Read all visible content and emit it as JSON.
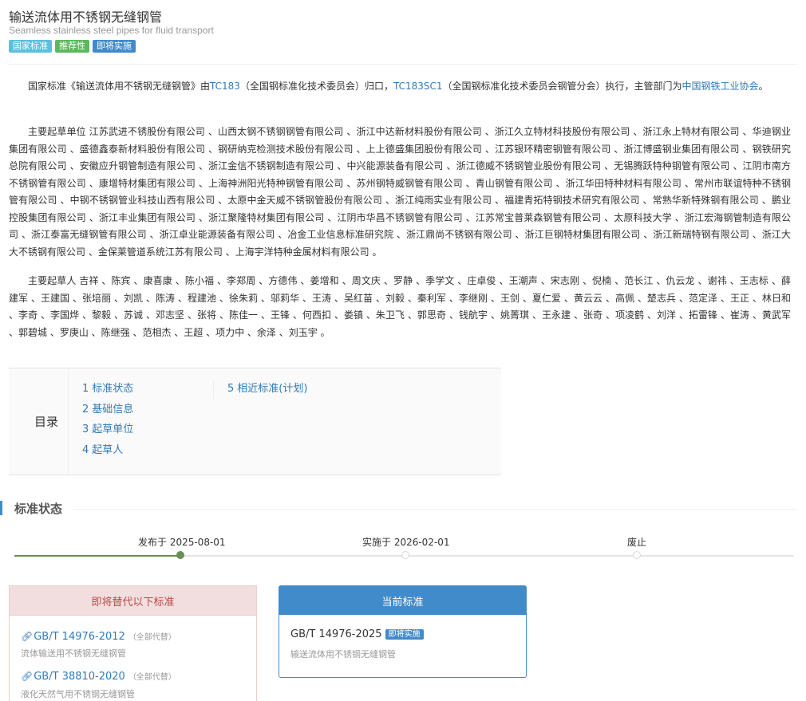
{
  "header": {
    "title": "输送流体用不锈钢无缝钢管",
    "subtitle": "Seamless stainless steel pipes for fluid transport",
    "badges": [
      "国家标准",
      "推荐性",
      "即将实施"
    ]
  },
  "intro": {
    "t1": "国家标准《输送流体用不锈钢无缝钢管》由",
    "tc1": "TC183",
    "t2": "（全国钢标准化技术委员会）归口，",
    "tc2": "TC183SC1",
    "t3": "（全国钢标准化技术委员会钢管分会）执行，主管部门为",
    "org": "中国钢铁工业协会",
    "t4": "。"
  },
  "drafting_units": "主要起草单位 江苏武进不锈股份有限公司 、山西太钢不锈钢钢管有限公司 、浙江中达新材料股份有限公司 、浙江久立特材科技股份有限公司 、浙江永上特材有限公司 、华迪钢业集团有限公司 、盛德鑫泰新材料股份有限公司 、钢研纳克检测技术股份有限公司 、上上德盛集团股份有限公司 、江苏银环精密钢管有限公司 、浙江博盛钢业集团有限公司 、钢铁研究总院有限公司 、安徽应升钢管制造有限公司 、浙江金信不锈钢制造有限公司 、中兴能源装备有限公司 、浙江德威不锈钢管业股份有限公司 、无锡腾跃特种钢管有限公司 、江阴市南方不锈钢管有限公司 、康增特材集团有限公司 、上海神洲阳光特种钢管有限公司 、苏州钢特威钢管有限公司 、青山钢管有限公司 、浙江华田特种材料有限公司 、常州市联谊特种不锈钢管有限公司 、中钢不锈钢管业科技山西有限公司 、太原中金天威不锈钢管股份有限公司 、浙江纯雨实业有限公司 、福建青拓特钢技术研究有限公司 、常熟华新特殊钢有限公司 、鹏业控股集团有限公司 、浙江丰业集团有限公司 、浙江聚隆特材集团有限公司 、江阴市华昌不锈钢管有限公司 、江苏常宝普莱森钢管有限公司 、太原科技大学 、浙江宏海钢管制造有限公司 、浙江泰富无缝钢管有限公司 、浙江卓业能源装备有限公司 、冶金工业信息标准研究院 、浙江鼎尚不锈钢有限公司 、浙江巨钢特材集团有限公司 、浙江新瑞特钢有限公司 、浙江大大不锈钢有限公司 、金保莱管道系统江苏有限公司 、上海宇洋特种金属材料有限公司 。",
  "drafters": "主要起草人 吉祥 、陈宾 、康喜康 、陈小福 、李郑周 、方德伟 、姜增和 、周文庆 、罗静 、季学文 、庄卓俊 、王潮声 、宋志刚 、倪楠 、范长江 、仇云龙 、谢祎 、王志标 、薛建军 、王建国 、张培丽 、刘凯 、陈涛 、程建池 、徐朱莉 、邬莉华 、王涛 、吴红苗 、刘毅 、秦利军 、李继刚 、王剑 、夏仁爱 、黄云云 、高佩 、楚志兵 、范定泽 、王正 、林日和 、李奇 、李国烨 、黎毅 、苏诚 、邓志坚 、张将 、陈佳一 、王锋 、何西扣 、娄镇 、朱卫飞 、郭思奇 、钱航宇 、姚菁琪 、王永建 、张奇 、项凌鹤 、刘洋 、拓雷锋 、崔涛 、黄武军 、郭碧城 、罗庚山 、陈继强 、范相杰 、王超 、项力中 、余泽 、刘玉宇 。",
  "toc": {
    "label": "目录",
    "items": [
      {
        "num": "1",
        "label": "标准状态"
      },
      {
        "num": "2",
        "label": "基础信息"
      },
      {
        "num": "3",
        "label": "起草单位"
      },
      {
        "num": "4",
        "label": "起草人"
      },
      {
        "num": "5",
        "label": "相近标准(计划)"
      }
    ]
  },
  "status_section": {
    "title": "标准状态",
    "timeline": [
      {
        "label": "发布于 2025-08-01",
        "state": "done"
      },
      {
        "label": "实施于 2026-02-01",
        "state": "pending"
      },
      {
        "label": "废止",
        "state": "pending"
      }
    ]
  },
  "replace_card": {
    "title": "即将替代以下标准",
    "items": [
      {
        "code": "GB/T 14976-2012",
        "tag": "（全部代替）",
        "name": "流体输送用不锈钢无缝钢管"
      },
      {
        "code": "GB/T 38810-2020",
        "tag": "（全部代替）",
        "name": "液化天然气用不锈钢无缝钢管"
      }
    ]
  },
  "current_card": {
    "title": "当前标准",
    "code": "GB/T 14976-2025",
    "badge": "即将实施",
    "name": "输送流体用不锈钢无缝钢管"
  },
  "colors": {
    "accent": "#428bca",
    "link": "#337ab7",
    "badge_teal": "#5bc0de",
    "badge_green": "#5cb85c",
    "timeline_done": "#6a8f57",
    "replace_head_bg": "#f2dede",
    "replace_head_text": "#b94a48"
  },
  "icons": {
    "link": "link-icon"
  }
}
